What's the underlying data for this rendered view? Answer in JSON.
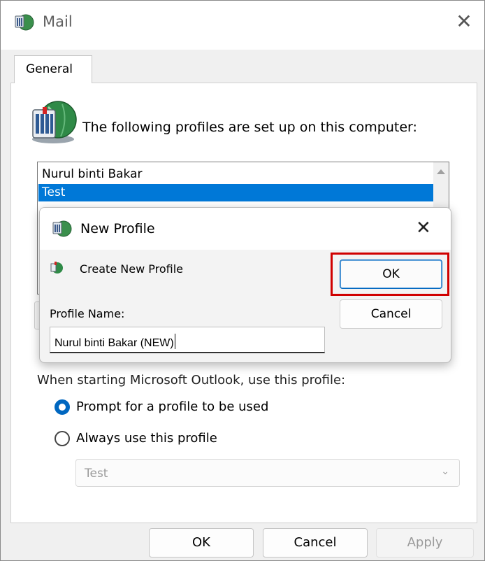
{
  "mail_window": {
    "title": "Mail",
    "icon": "mail-app-icon",
    "tabs": [
      "General"
    ],
    "profiles_heading": "The following profiles are set up on this computer:",
    "profiles": [
      "Nurul binti Bakar",
      "Test"
    ],
    "selected_profile_index": 1,
    "startup_label": "When starting Microsoft Outlook, use this profile:",
    "radio_options": [
      "Prompt for a profile to be used",
      "Always use this profile"
    ],
    "selected_radio_index": 0,
    "always_profile_value": "Test",
    "buttons": {
      "ok": "OK",
      "cancel": "Cancel",
      "apply": "Apply"
    }
  },
  "new_profile_dialog": {
    "title": "New Profile",
    "create_label": "Create New Profile",
    "name_label": "Profile Name:",
    "name_value": "Nurul binti Bakar (NEW)",
    "buttons": {
      "ok": "OK",
      "cancel": "Cancel"
    },
    "highlight_color": "#d00000"
  },
  "colors": {
    "selection": "#0078d7",
    "accent": "#0067c0"
  }
}
